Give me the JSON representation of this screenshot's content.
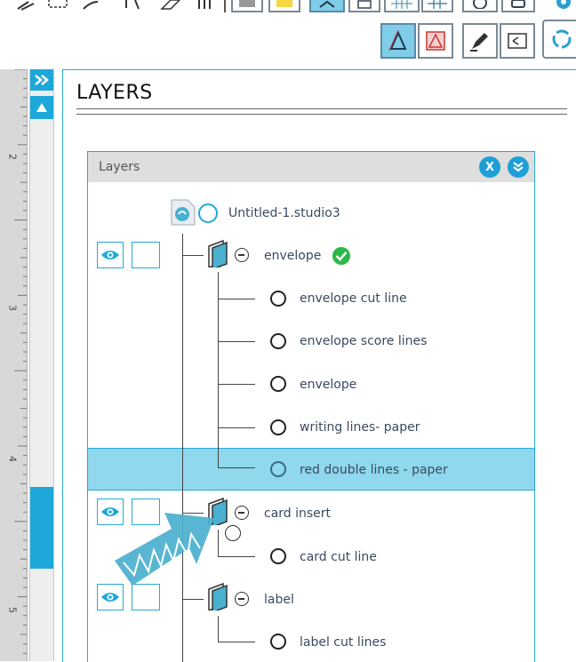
{
  "panel": {
    "title": "LAYERS",
    "inner_title": "Layers",
    "close_glyph": "X",
    "collapse_glyph": "»"
  },
  "ruler": {
    "ticks": [
      "2",
      "3",
      "4",
      "5"
    ]
  },
  "document": {
    "name": "Untitled-1.studio3"
  },
  "groups": [
    {
      "name": "envelope",
      "checked": true,
      "layers": [
        {
          "name": "envelope cut line",
          "selected": false
        },
        {
          "name": "envelope score lines",
          "selected": false
        },
        {
          "name": "envelope",
          "selected": false
        },
        {
          "name": "writing lines- paper",
          "selected": false
        },
        {
          "name": "red double lines - paper",
          "selected": true
        }
      ]
    },
    {
      "name": "card insert",
      "checked": false,
      "layers": [
        {
          "name": "card cut line",
          "selected": false
        }
      ]
    },
    {
      "name": "label",
      "checked": false,
      "layers": [
        {
          "name": "label cut lines",
          "selected": false
        }
      ]
    }
  ],
  "colors": {
    "accent": "#29a9d6",
    "selected_row": "#8fd8ee",
    "check": "#2db84a",
    "arrow": "#4ab0cf"
  }
}
